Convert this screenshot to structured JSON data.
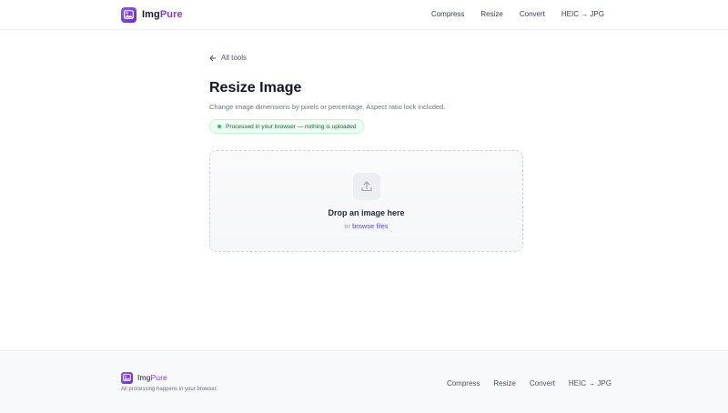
{
  "brand": {
    "name_part1": "Img",
    "name_part2": "Pure",
    "accent": "#7c3aed"
  },
  "nav": {
    "items": [
      "Compress",
      "Resize",
      "Convert",
      "HEIC → JPG"
    ]
  },
  "main": {
    "back_label": "All tools",
    "title": "Resize Image",
    "subtitle": "Change image dimensions by pixels or percentage. Aspect ratio lock included.",
    "badge": "Processed in your browser — nothing is uploaded",
    "dropzone": {
      "title": "Drop an image here",
      "or": "or",
      "browse": "browse files",
      "icon": "upload-icon"
    }
  },
  "footer": {
    "tagline": "All processing happens in your browser.",
    "nav": [
      "Compress",
      "Resize",
      "Convert",
      "HEIC → JPG"
    ]
  }
}
